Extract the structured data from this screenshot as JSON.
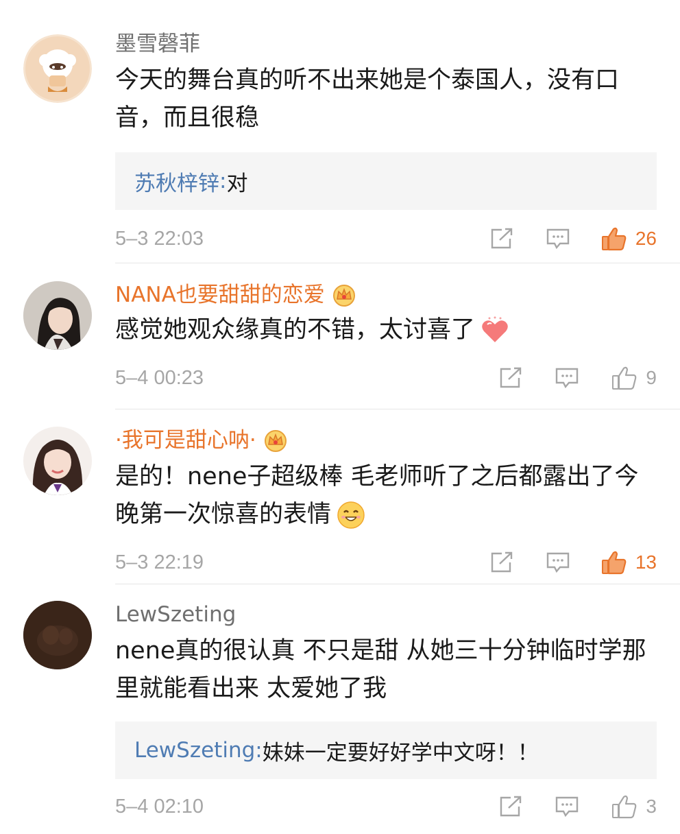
{
  "comments": [
    {
      "username": "墨雪磬菲",
      "vip": false,
      "text": "今天的舞台真的听不出来她是个泰国人，没有口音，而且很稳",
      "reply": {
        "name": "苏秋梓锌",
        "colon": ": ",
        "text": "对"
      },
      "time": "5–3 22:03",
      "likes": "26",
      "liked": true
    },
    {
      "username": "NANA也要甜甜的恋爱",
      "vip": true,
      "text": "感觉她观众缘真的不错，太讨喜了",
      "emoji": "heart-emoji",
      "time": "5–4 00:23",
      "likes": "9",
      "liked": false
    },
    {
      "username": "·我可是甜心呐·",
      "vip": true,
      "text": "是的！nene子超级棒 毛老师听了之后都露出了今晚第一次惊喜的表情",
      "emoji": "smile-emoji",
      "time": "5–3 22:19",
      "likes": "13",
      "liked": true
    },
    {
      "username": "LewSzeting",
      "vip": false,
      "text": "nene真的很认真 不只是甜 从她三十分钟临时学那里就能看出来 太爱她了我",
      "reply": {
        "name": "LewSzeting",
        "colon": ": ",
        "text": "妹妹一定要好好学中文呀！！"
      },
      "time": "5–4 02:10",
      "likes": "3",
      "liked": false
    }
  ],
  "colors": {
    "accent": "#e8742b",
    "reply_name": "#4f7cb3",
    "meta_gray": "#a6a6a6"
  }
}
